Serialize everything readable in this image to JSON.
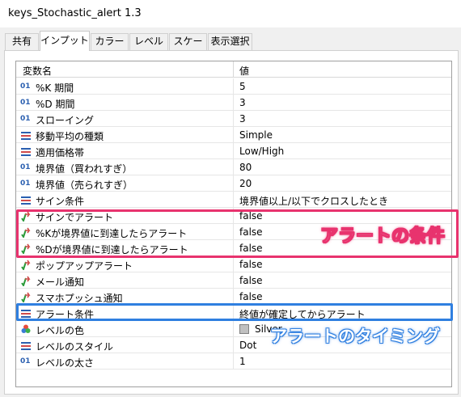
{
  "window": {
    "title": "keys_Stochastic_alert 1.3"
  },
  "tabs": [
    "共有",
    "インプット",
    "カラー",
    "レベル",
    "スケール",
    "表示選択"
  ],
  "table": {
    "header": {
      "name": "変数名",
      "value": "値"
    },
    "rows": [
      {
        "icon": "int-icon",
        "name": "%K 期間",
        "value": "5"
      },
      {
        "icon": "int-icon",
        "name": "%D 期間",
        "value": "3"
      },
      {
        "icon": "int-icon",
        "name": "スローイング",
        "value": "3"
      },
      {
        "icon": "enum-icon",
        "name": "移動平均の種類",
        "value": "Simple"
      },
      {
        "icon": "enum-icon",
        "name": "適用価格帯",
        "value": "Low/High"
      },
      {
        "icon": "int-icon",
        "name": "境界値（買われすぎ）",
        "value": "80"
      },
      {
        "icon": "int-icon",
        "name": "境界値（売られすぎ）",
        "value": "20"
      },
      {
        "icon": "enum-icon",
        "name": "サイン条件",
        "value": "境界値以上/以下でクロスしたとき"
      },
      {
        "icon": "bool-icon",
        "name": "サインでアラート",
        "value": "false"
      },
      {
        "icon": "bool-icon",
        "name": "%Kが境界値に到達したらアラート",
        "value": "false"
      },
      {
        "icon": "bool-icon",
        "name": "%Dが境界値に到達したらアラート",
        "value": "false"
      },
      {
        "icon": "bool-icon",
        "name": "ポップアップアラート",
        "value": "false"
      },
      {
        "icon": "bool-icon",
        "name": "メール通知",
        "value": "false"
      },
      {
        "icon": "bool-icon",
        "name": "スマホプッシュ通知",
        "value": "false"
      },
      {
        "icon": "enum-icon",
        "name": "アラート条件",
        "value": "終値が確定してからアラート"
      },
      {
        "icon": "color-icon",
        "name": "レベルの色",
        "value": "Silver"
      },
      {
        "icon": "enum-icon",
        "name": "レベルのスタイル",
        "value": "Dot"
      },
      {
        "icon": "int-icon",
        "name": "レベルの太さ",
        "value": "1"
      }
    ]
  },
  "annotations": {
    "alert_conditions": "アラートの条件",
    "alert_timing": "アラートのタイミング"
  },
  "colors": {
    "highlight_red": "#e8336e",
    "highlight_blue": "#2f7fe0",
    "swatch": "#c0c0c0"
  },
  "int_icon_glyph": "01"
}
